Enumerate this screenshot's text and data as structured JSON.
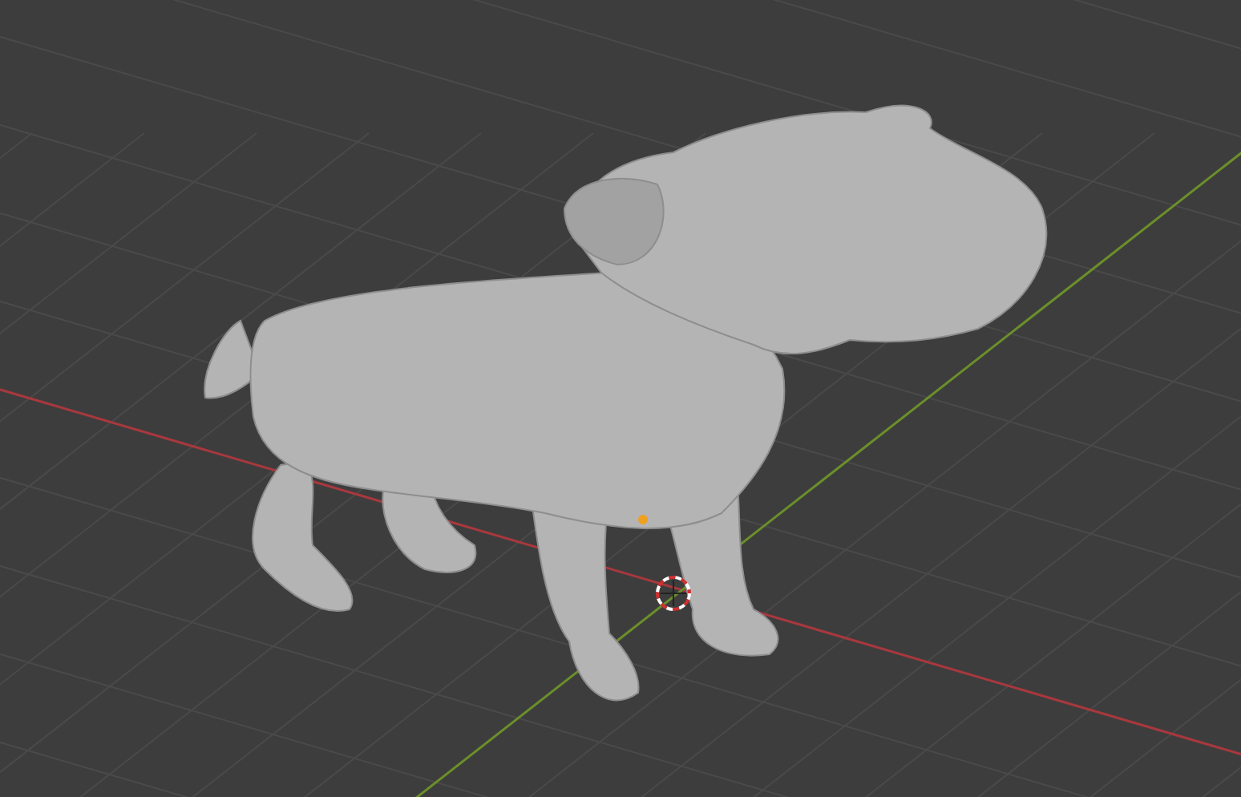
{
  "viewport": {
    "axes": [
      {
        "kind": "x",
        "color": "#a8383e"
      },
      {
        "kind": "y",
        "color": "#6a8f2a"
      }
    ]
  }
}
